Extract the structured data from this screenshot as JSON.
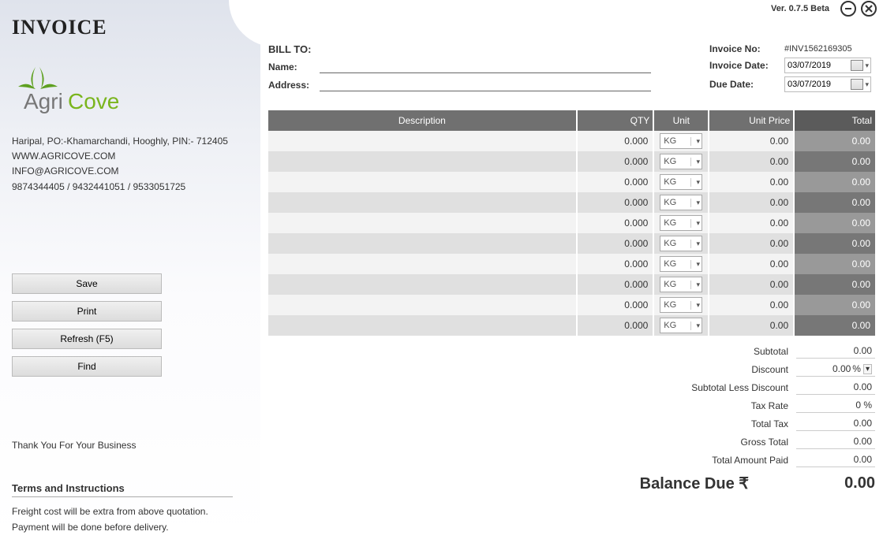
{
  "version": "Ver. 0.7.5 Beta",
  "title": "INVOICE",
  "logo": {
    "p1": "Agri",
    "p2": "Cove"
  },
  "company": {
    "addr": "Haripal, PO:-Khamarchandi, Hooghly, PIN:- 712405",
    "web": "WWW.AGRICOVE.COM",
    "email": "INFO@AGRICOVE.COM",
    "phones": "9874344405 / 9432441051 / 9533051725"
  },
  "buttons": {
    "save": "Save",
    "print": "Print",
    "refresh": "Refresh (F5)",
    "find": "Find"
  },
  "thankyou": "Thank You For Your Business",
  "terms_title": "Terms and Instructions",
  "terms_1": "Freight cost will be extra from above quotation.",
  "terms_2": "Payment will be done before delivery.",
  "bill": {
    "to": "BILL TO:",
    "name_lbl": "Name:",
    "addr_lbl": "Address:",
    "name_val": "",
    "addr_val": ""
  },
  "meta": {
    "invno_lbl": "Invoice No:",
    "invno_val": "#INV1562169305",
    "invdate_lbl": "Invoice Date:",
    "invdate_val": "03/07/2019",
    "duedate_lbl": "Due Date:",
    "duedate_val": "03/07/2019"
  },
  "headers": {
    "desc": "Description",
    "qty": "QTY",
    "unit": "Unit",
    "price": "Unit Price",
    "total": "Total"
  },
  "row": {
    "qty": "0.000",
    "unit": "KG",
    "price": "0.00",
    "total": "0.00"
  },
  "totals": {
    "subtotal_lbl": "Subtotal",
    "subtotal": "0.00",
    "discount_lbl": "Discount",
    "discount": "0.00",
    "discount_unit": "%",
    "subless_lbl": "Subtotal Less Discount",
    "subless": "0.00",
    "taxrate_lbl": "Tax Rate",
    "taxrate": "0 %",
    "totaltax_lbl": "Total Tax",
    "totaltax": "0.00",
    "gross_lbl": "Gross Total",
    "gross": "0.00",
    "paid_lbl": "Total Amount Paid",
    "paid": "0.00"
  },
  "balance": {
    "lbl": "Balance Due  ₹",
    "amt": "0.00"
  }
}
